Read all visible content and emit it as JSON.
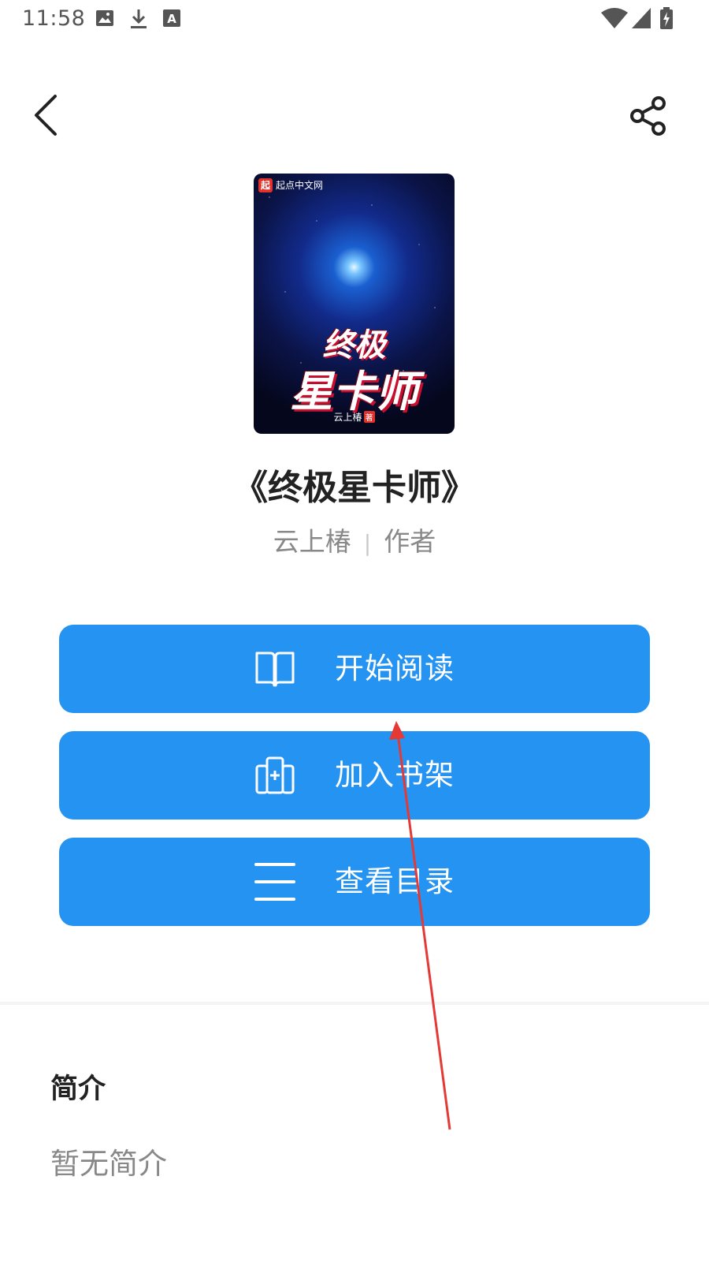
{
  "status_bar": {
    "time": "11:58",
    "notification_icons": [
      "image-icon",
      "download-icon",
      "text-a-icon"
    ],
    "right_icons": [
      "wifi-icon",
      "signal-icon",
      "battery-charging-icon"
    ]
  },
  "nav": {
    "back_icon": "chevron-left-icon",
    "share_icon": "share-icon"
  },
  "cover": {
    "publisher_mark": "起",
    "publisher": "起点中文网",
    "title_line1": "终极",
    "title_line2": "星卡师",
    "author": "云上椿",
    "author_mark": "著"
  },
  "book": {
    "title": "《终极星卡师》",
    "author": "云上椿",
    "separator": "|",
    "author_role": "作者"
  },
  "actions": [
    {
      "label": "开始阅读",
      "icon": "open-book-icon"
    },
    {
      "label": "加入书架",
      "icon": "add-to-shelf-icon"
    },
    {
      "label": "查看目录",
      "icon": "list-icon"
    }
  ],
  "intro": {
    "heading": "简介",
    "text": "暂无简介"
  },
  "colors": {
    "primary": "#2493f2",
    "annotation": "#e53935"
  }
}
